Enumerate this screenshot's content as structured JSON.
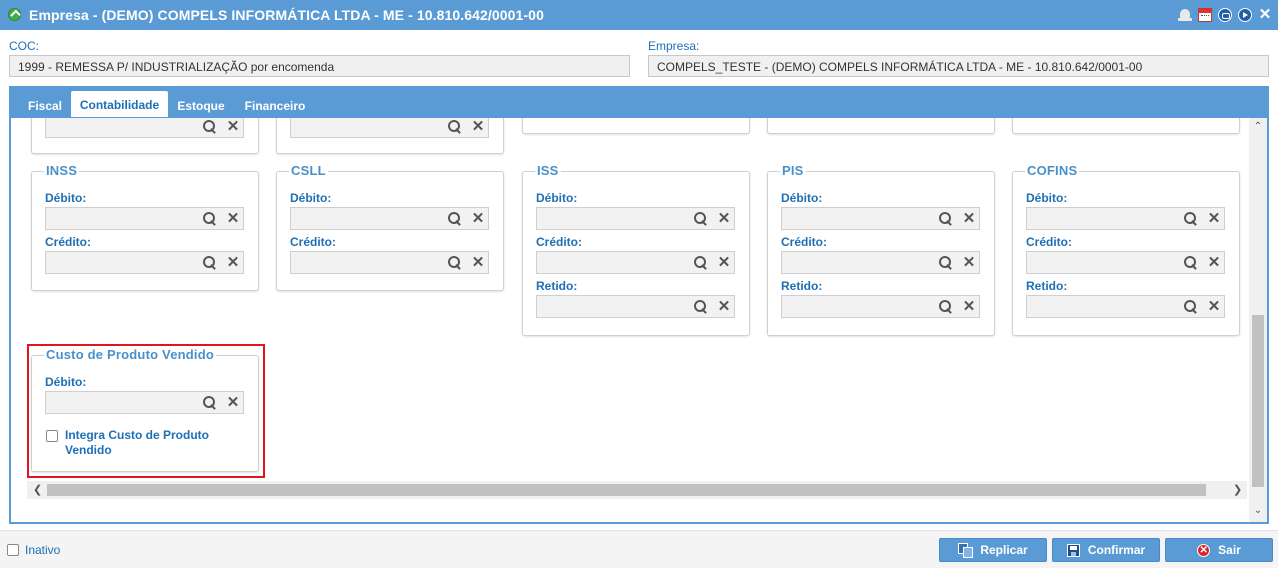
{
  "window": {
    "title": "Empresa - (DEMO) COMPELS INFORMÁTICA LTDA - ME - 10.810.642/0001-00",
    "icons": [
      "bell-icon",
      "calendar-icon",
      "circle-icon",
      "play-icon",
      "close-icon"
    ]
  },
  "header": {
    "coc_label": "COC:",
    "coc_value": "1999 - REMESSA P/ INDUSTRIALIZAÇÃO por encomenda",
    "empresa_label": "Empresa:",
    "empresa_value": "COMPELS_TESTE - (DEMO) COMPELS INFORMÁTICA LTDA - ME - 10.810.642/0001-00"
  },
  "tabs": [
    {
      "label": "Fiscal",
      "active": false
    },
    {
      "label": "Contabilidade",
      "active": true
    },
    {
      "label": "Estoque",
      "active": false
    },
    {
      "label": "Financeiro",
      "active": false
    }
  ],
  "groups": {
    "inss": {
      "title": "INSS",
      "debito_label": "Débito:",
      "credito_label": "Crédito:"
    },
    "csll": {
      "title": "CSLL",
      "debito_label": "Débito:",
      "credito_label": "Crédito:"
    },
    "iss": {
      "title": "ISS",
      "debito_label": "Débito:",
      "credito_label": "Crédito:",
      "retido_label": "Retido:"
    },
    "pis": {
      "title": "PIS",
      "debito_label": "Débito:",
      "credito_label": "Crédito:",
      "retido_label": "Retido:"
    },
    "cofins": {
      "title": "COFINS",
      "debito_label": "Débito:",
      "credito_label": "Crédito:",
      "retido_label": "Retido:"
    },
    "cpv": {
      "title": "Custo de Produto Vendido",
      "debito_label": "Débito:",
      "checkbox_label_line1": "Integra Custo de Produto",
      "checkbox_label_line2": "Vendido",
      "checked": false
    }
  },
  "footer": {
    "inativo_label": "Inativo",
    "inativo_checked": false,
    "replicar_label": "Replicar",
    "confirmar_label": "Confirmar",
    "sair_label": "Sair"
  },
  "colors": {
    "accent": "#5b9bd5",
    "label_blue": "#1f6fb5",
    "highlight_red": "#e0141e",
    "exit_red": "#d8262e"
  }
}
